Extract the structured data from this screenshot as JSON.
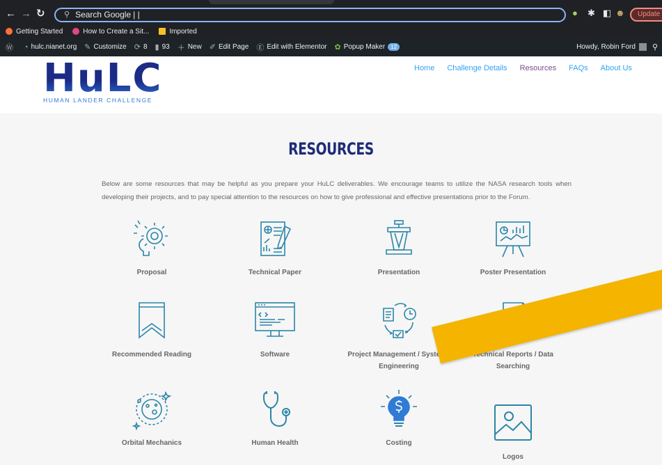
{
  "browser": {
    "omnibox_text": "Search Google",
    "update_label": "Update",
    "bookmarks": [
      {
        "label": "Getting Started",
        "color": "#ff7139"
      },
      {
        "label": "How to Create a Sit...",
        "color": "#e04786"
      },
      {
        "label": "Imported",
        "color": "#f6c026"
      }
    ]
  },
  "adminbar": {
    "site": "hulc.nianet.org",
    "customize": "Customize",
    "updates": "8",
    "comments": "93",
    "new": "New",
    "edit_page": "Edit Page",
    "elementor": "Edit with Elementor",
    "popup": "Popup Maker",
    "popup_count": "12",
    "howdy": "Howdy, Robin Ford"
  },
  "header": {
    "logo_main": "HuLC",
    "logo_sub": "HUMAN LANDER CHALLENGE",
    "nav": [
      {
        "label": "Home",
        "active": false
      },
      {
        "label": "Challenge Details",
        "active": false
      },
      {
        "label": "Resources",
        "active": true
      },
      {
        "label": "FAQs",
        "active": false
      },
      {
        "label": "About Us",
        "active": false
      }
    ]
  },
  "main": {
    "title": "RESOURCES",
    "intro": "Below are some resources that may be helpful as you prepare your HuLC deliverables. We encourage teams to utilize the NASA research tools when developing their projects, and to pay special attention to the resources on how to give professional and effective presentations prior to the Forum.",
    "resources": [
      {
        "label": "Proposal",
        "icon": "gear-bulb-icon"
      },
      {
        "label": "Technical Paper",
        "icon": "technical-paper-icon"
      },
      {
        "label": "Presentation",
        "icon": "podium-icon"
      },
      {
        "label": "Poster Presentation",
        "icon": "poster-easel-icon"
      },
      {
        "label": "Recommended Reading",
        "icon": "bookmark-icon"
      },
      {
        "label": "Software",
        "icon": "code-monitor-icon"
      },
      {
        "label": "Project Management / Systems Engineering",
        "icon": "workflow-cycle-icon"
      },
      {
        "label": "Technical Reports / Data Searching",
        "icon": "report-search-icon"
      },
      {
        "label": "Orbital Mechanics",
        "icon": "orbit-planet-icon"
      },
      {
        "label": "Human Health",
        "icon": "stethoscope-icon"
      },
      {
        "label": "Costing",
        "icon": "dollar-bulb-icon"
      },
      {
        "label": "Logos",
        "icon": "image-icon"
      }
    ]
  },
  "colors": {
    "icon_teal": "#2a86a8",
    "title_navy": "#1e2b7a",
    "nav_blue": "#2ea3f2",
    "nav_active": "#7a4c8c",
    "arrow_yellow": "#f4b400"
  }
}
